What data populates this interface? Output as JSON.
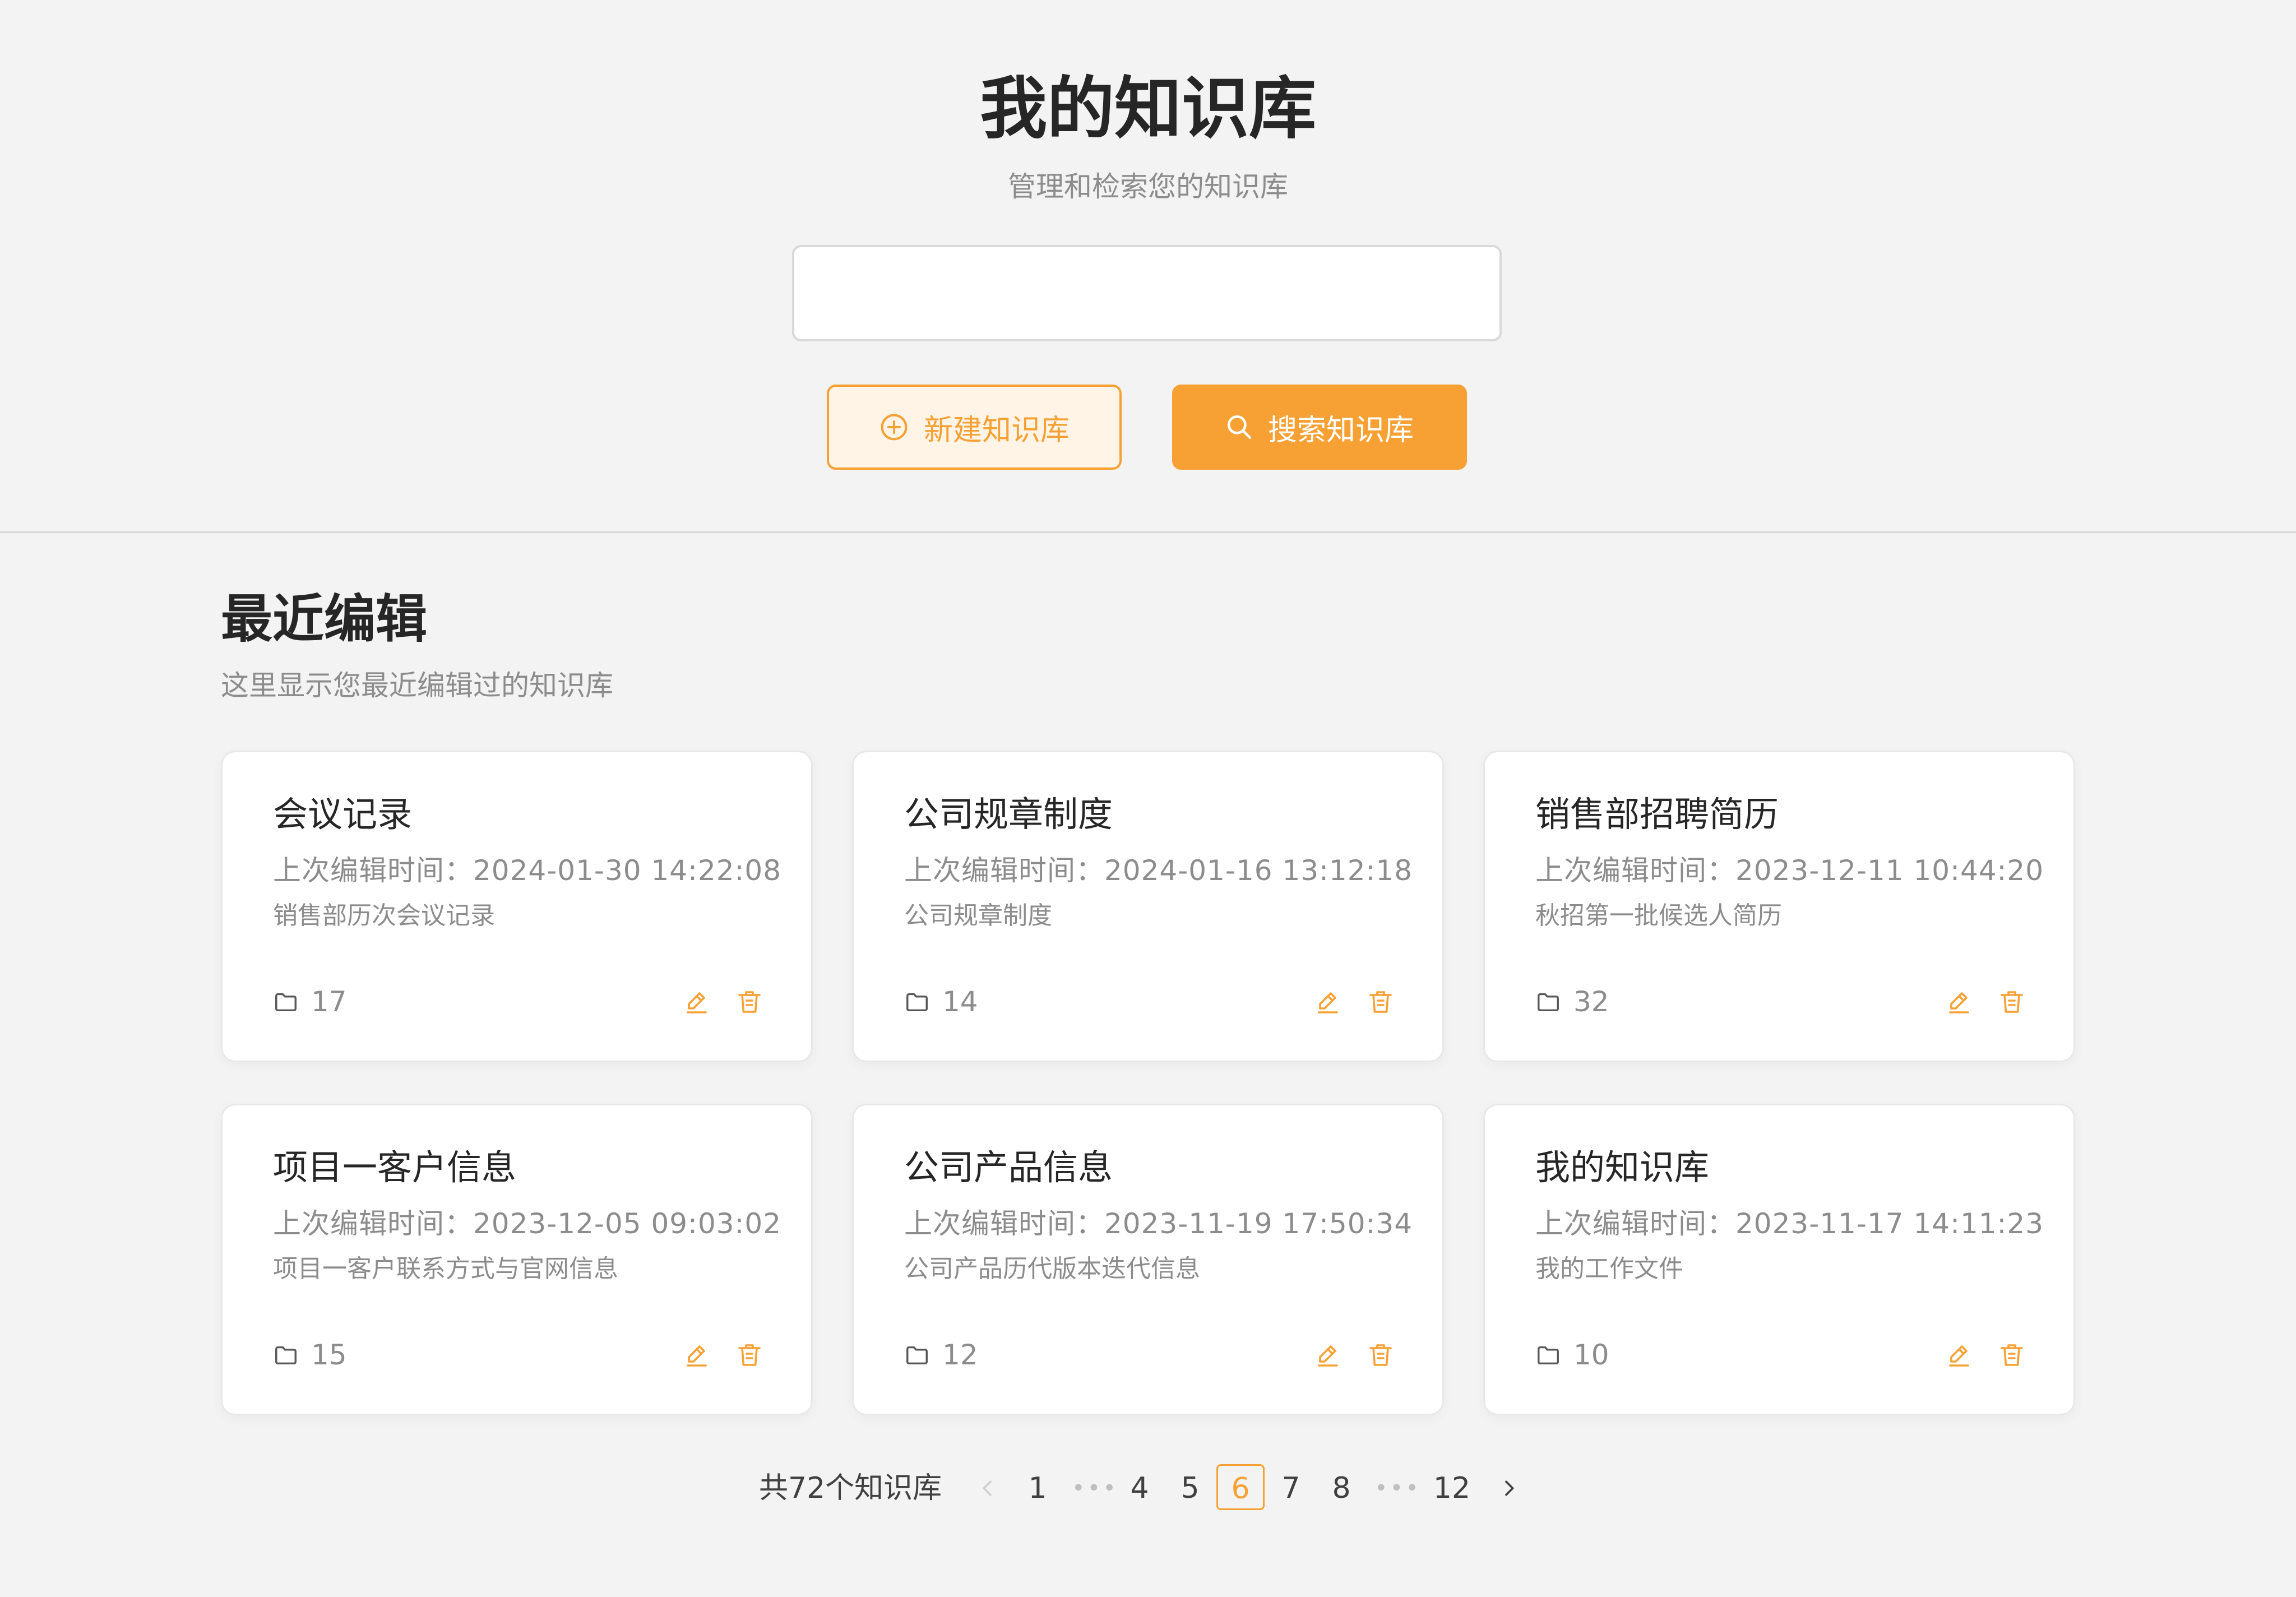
{
  "header": {
    "title": "我的知识库",
    "subtitle": "管理和检索您的知识库",
    "search_value": "",
    "new_button_label": "新建知识库",
    "search_button_label": "搜索知识库"
  },
  "recent": {
    "title": "最近编辑",
    "description": "这里显示您最近编辑过的知识库"
  },
  "cards": [
    {
      "title": "会议记录",
      "time": "上次编辑时间：2024-01-30 14:22:08",
      "desc": "销售部历次会议记录",
      "count": "17"
    },
    {
      "title": "公司规章制度",
      "time": "上次编辑时间：2024-01-16 13:12:18",
      "desc": "公司规章制度",
      "count": "14"
    },
    {
      "title": "销售部招聘简历",
      "time": "上次编辑时间：2023-12-11 10:44:20",
      "desc": "秋招第一批候选人简历",
      "count": "32"
    },
    {
      "title": "项目一客户信息",
      "time": "上次编辑时间：2023-12-05 09:03:02",
      "desc": "项目一客户联系方式与官网信息",
      "count": "15"
    },
    {
      "title": "公司产品信息",
      "time": "上次编辑时间：2023-11-19 17:50:34",
      "desc": "公司产品历代版本迭代信息",
      "count": "12"
    },
    {
      "title": "我的知识库",
      "time": "上次编辑时间：2023-11-17 14:11:23",
      "desc": "我的工作文件",
      "count": "10"
    }
  ],
  "pagination": {
    "total_label": "共72个知识库",
    "pages": [
      "1",
      "4",
      "5",
      "6",
      "7",
      "8",
      "12"
    ],
    "current": "6",
    "dots": "•••"
  },
  "colors": {
    "accent": "#f7a034",
    "accent_light": "#fff4e5",
    "background": "#f3f3f3"
  },
  "icons": {
    "new_button": "plus-circle-icon",
    "search_button": "search-icon",
    "card_count": "folder-icon",
    "card_edit": "pencil-icon",
    "card_delete": "trash-icon",
    "pagination_prev": "chevron-left-icon",
    "pagination_next": "chevron-right-icon"
  }
}
